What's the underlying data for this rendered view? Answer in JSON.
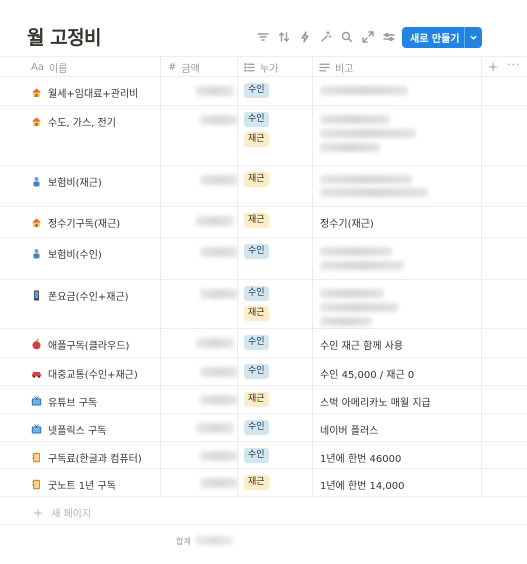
{
  "page": {
    "title": "월 고정비"
  },
  "toolbar": {
    "icons": [
      "filter-icon",
      "sort-icon",
      "automation-icon",
      "ai-sparkle-icon",
      "search-icon",
      "expand-icon",
      "settings-icon"
    ],
    "new_button_label": "새로 만들기",
    "accent_color": "#2383e2"
  },
  "columns": {
    "name": {
      "label": "이름",
      "icon_text": "Aa"
    },
    "amount": {
      "label": "금액",
      "icon_text": "#"
    },
    "who": {
      "label": "누가"
    },
    "note": {
      "label": "비고"
    }
  },
  "rows": [
    {
      "name": "월세+임대료+관리비",
      "icon": "house-icon",
      "tags": [
        "수인"
      ],
      "note": ""
    },
    {
      "name": "수도, 가스, 전기",
      "icon": "house-icon",
      "tags": [
        "수인",
        "재근"
      ],
      "note": ""
    },
    {
      "name": "보험비(재근)",
      "icon": "person-icon",
      "tags": [
        "재근"
      ],
      "note": ""
    },
    {
      "name": "정수기구독(재근)",
      "icon": "house-icon",
      "tags": [
        "재근"
      ],
      "note": "정수기(재근)"
    },
    {
      "name": "보험비(수인)",
      "icon": "person-icon",
      "tags": [
        "수인"
      ],
      "note": ""
    },
    {
      "name": "폰요금(수인+재근)",
      "icon": "phone-icon",
      "tags": [
        "수인",
        "재근"
      ],
      "note": ""
    },
    {
      "name": "애플구독(클라우드)",
      "icon": "apple-icon",
      "tags": [
        "수인"
      ],
      "note": "수인 재근 함께 사용"
    },
    {
      "name": "대중교통(수인+재근)",
      "icon": "car-icon",
      "tags": [
        "수인"
      ],
      "note": "수인 45,000 / 재근 0"
    },
    {
      "name": "유튜브 구독",
      "icon": "tv-icon",
      "tags": [
        "재근"
      ],
      "note": "스벅 아메리카노 매월 지급"
    },
    {
      "name": "넷플릭스 구독",
      "icon": "tv-icon",
      "tags": [
        "수인"
      ],
      "note": "네이버 플러스"
    },
    {
      "name": "구독료(한글과 컴퓨터)",
      "icon": "notebook-icon",
      "tags": [
        "수인"
      ],
      "note": "1년에 한번 46000"
    },
    {
      "name": "굿노트 1년 구독",
      "icon": "notebook-icon",
      "tags": [
        "재근"
      ],
      "note": "1년에 한번 14,000"
    }
  ],
  "tag_colors": {
    "수인": "#d3e5ef",
    "재근": "#fdecc8"
  },
  "add_row": {
    "plus": "+",
    "label": "새 페이지"
  },
  "footer": {
    "sum_label": "합계"
  }
}
